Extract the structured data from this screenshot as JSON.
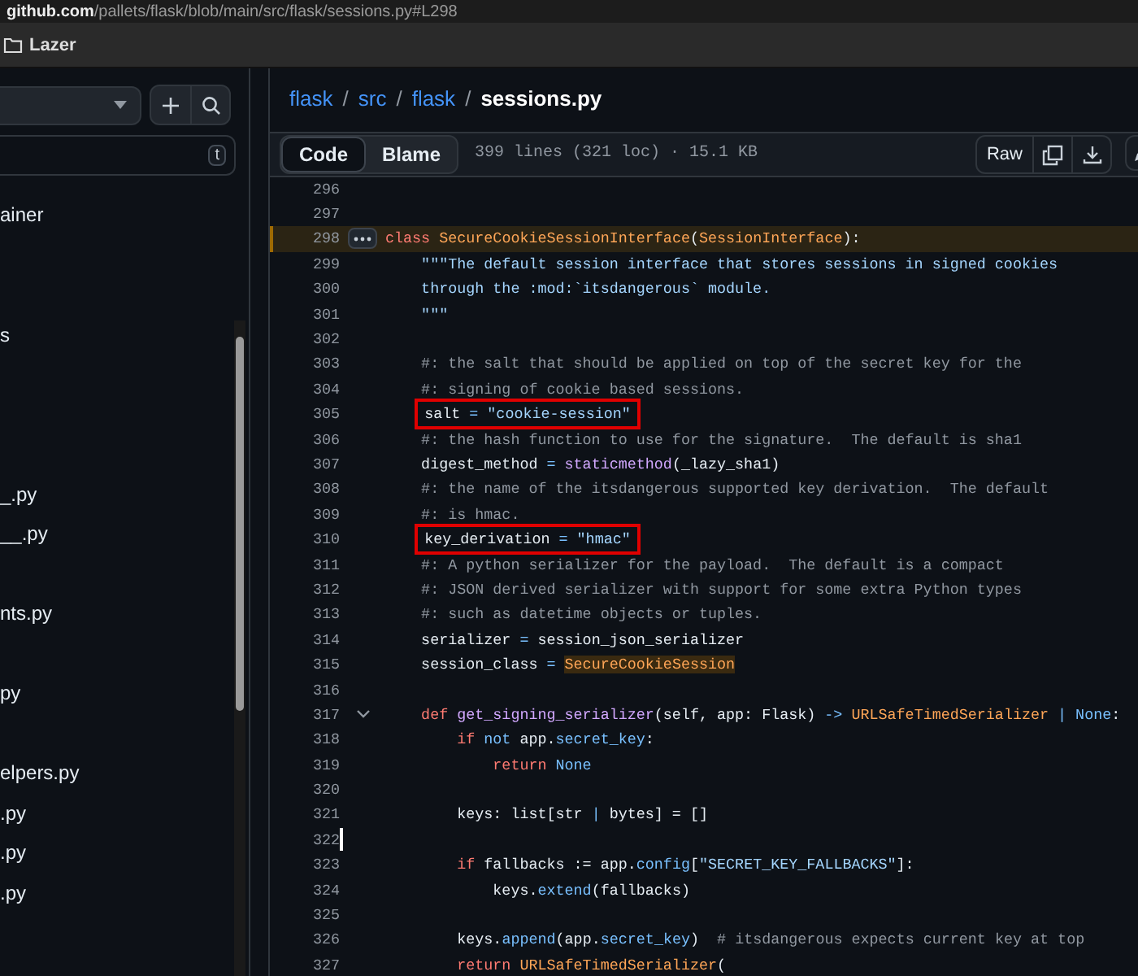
{
  "address_bar": {
    "host": "github.com",
    "path": "/pallets/flask/blob/main/src/flask/sessions.py#L298"
  },
  "bookmarks": [
    {
      "label": "Lazer"
    }
  ],
  "sidebar": {
    "filter_placeholder_key": "t",
    "items": [
      {
        "label": "ainer"
      },
      {
        "label": "s"
      },
      {
        "label": "_.py"
      },
      {
        "label": "__.py"
      },
      {
        "label": "nts.py"
      },
      {
        "label": "py"
      },
      {
        "label": "elpers.py"
      },
      {
        "label": ".py"
      },
      {
        "label": ".py"
      },
      {
        "label": ".py"
      }
    ]
  },
  "breadcrumb": [
    {
      "label": "flask",
      "kind": "link"
    },
    {
      "label": "/",
      "kind": "sep"
    },
    {
      "label": "src",
      "kind": "link"
    },
    {
      "label": "/",
      "kind": "sep"
    },
    {
      "label": "flask",
      "kind": "link"
    },
    {
      "label": "/",
      "kind": "sep"
    },
    {
      "label": "sessions.py",
      "kind": "current"
    }
  ],
  "view_tabs": [
    {
      "label": "Code",
      "selected": true
    },
    {
      "label": "Blame",
      "selected": false
    }
  ],
  "file_info": "399 lines (321 loc) · 15.1 KB",
  "raw_button": "Raw",
  "lines": [
    {
      "number": "296",
      "selected": false,
      "boxed": false
    },
    {
      "number": "297",
      "selected": false,
      "boxed": false
    },
    {
      "number": "298",
      "selected": true,
      "boxed": false,
      "kind": "menu",
      "tokens": [
        {
          "kind": "keyword",
          "text": "class "
        },
        {
          "kind": "type",
          "text": "SecureCookieSessionInterface"
        },
        {
          "kind": "plain",
          "text": "("
        },
        {
          "kind": "type",
          "text": "SessionInterface"
        },
        {
          "kind": "plain",
          "text": "):"
        }
      ]
    },
    {
      "number": "299",
      "selected": false,
      "boxed": false,
      "tokens": [
        {
          "kind": "string",
          "text": "    \"\"\"The default session interface that stores sessions in signed cookies"
        }
      ]
    },
    {
      "number": "300",
      "selected": false,
      "boxed": false,
      "tokens": [
        {
          "kind": "string",
          "text": "    through the :mod:`itsdangerous` module."
        }
      ]
    },
    {
      "number": "301",
      "selected": false,
      "boxed": false,
      "tokens": [
        {
          "kind": "string",
          "text": "    \"\"\""
        }
      ]
    },
    {
      "number": "302",
      "selected": false,
      "boxed": false
    },
    {
      "number": "303",
      "selected": false,
      "boxed": false,
      "tokens": [
        {
          "kind": "comment",
          "text": "    #: the salt that should be applied on top of the secret key for the"
        }
      ]
    },
    {
      "number": "304",
      "selected": false,
      "boxed": false,
      "tokens": [
        {
          "kind": "comment",
          "text": "    #: signing of cookie based sessions."
        }
      ]
    },
    {
      "number": "305",
      "selected": false,
      "boxed": true,
      "tokens": [
        {
          "kind": "plain",
          "text": "    salt "
        },
        {
          "kind": "builtin",
          "text": "="
        },
        {
          "kind": "string",
          "text": " \"cookie-session\""
        }
      ]
    },
    {
      "number": "306",
      "selected": false,
      "boxed": false,
      "tokens": [
        {
          "kind": "comment",
          "text": "    #: the hash function to use for the signature.  The default is sha1"
        }
      ]
    },
    {
      "number": "307",
      "selected": false,
      "boxed": false,
      "tokens": [
        {
          "kind": "plain",
          "text": "    digest_method "
        },
        {
          "kind": "builtin",
          "text": "= "
        },
        {
          "kind": "function",
          "text": "staticmethod"
        },
        {
          "kind": "plain",
          "text": "(_lazy_sha1)"
        }
      ]
    },
    {
      "number": "308",
      "selected": false,
      "boxed": false,
      "tokens": [
        {
          "kind": "comment",
          "text": "    #: the name of the itsdangerous supported key derivation.  The default"
        }
      ]
    },
    {
      "number": "309",
      "selected": false,
      "boxed": false,
      "tokens": [
        {
          "kind": "comment",
          "text": "    #: is hmac."
        }
      ]
    },
    {
      "number": "310",
      "selected": false,
      "boxed": true,
      "tokens": [
        {
          "kind": "plain",
          "text": "    key_derivation "
        },
        {
          "kind": "builtin",
          "text": "="
        },
        {
          "kind": "string",
          "text": " \"hmac\""
        }
      ]
    },
    {
      "number": "311",
      "selected": false,
      "boxed": false,
      "tokens": [
        {
          "kind": "comment",
          "text": "    #: A python serializer for the payload.  The default is a compact"
        }
      ]
    },
    {
      "number": "312",
      "selected": false,
      "boxed": false,
      "tokens": [
        {
          "kind": "comment",
          "text": "    #: JSON derived serializer with support for some extra Python types"
        }
      ]
    },
    {
      "number": "313",
      "selected": false,
      "boxed": false,
      "tokens": [
        {
          "kind": "comment",
          "text": "    #: such as datetime objects or tuples."
        }
      ]
    },
    {
      "number": "314",
      "selected": false,
      "boxed": false,
      "tokens": [
        {
          "kind": "plain",
          "text": "    serializer "
        },
        {
          "kind": "builtin",
          "text": "="
        },
        {
          "kind": "plain",
          "text": " session_json_serializer"
        }
      ]
    },
    {
      "number": "315",
      "selected": false,
      "boxed": false,
      "tokens": [
        {
          "kind": "plain",
          "text": "    session_class "
        },
        {
          "kind": "builtin",
          "text": "= "
        },
        {
          "kind": "match",
          "text": "SecureCookieSession"
        }
      ]
    },
    {
      "number": "316",
      "selected": false,
      "boxed": false
    },
    {
      "number": "317",
      "selected": false,
      "boxed": false,
      "kind": "fold",
      "tokens": [
        {
          "kind": "keyword",
          "text": "    def "
        },
        {
          "kind": "function",
          "text": "get_signing_serializer"
        },
        {
          "kind": "plain",
          "text": "(self, app: Flask) "
        },
        {
          "kind": "builtin",
          "text": "-> "
        },
        {
          "kind": "type",
          "text": "URLSafeTimedSerializer "
        },
        {
          "kind": "builtin",
          "text": "| None"
        },
        {
          "kind": "plain",
          "text": ":"
        }
      ]
    },
    {
      "number": "318",
      "selected": false,
      "boxed": false,
      "tokens": [
        {
          "kind": "keyword",
          "text": "        if "
        },
        {
          "kind": "builtin",
          "text": "not"
        },
        {
          "kind": "plain",
          "text": " app."
        },
        {
          "kind": "builtin",
          "text": "secret_key"
        },
        {
          "kind": "plain",
          "text": ":"
        }
      ]
    },
    {
      "number": "319",
      "selected": false,
      "boxed": false,
      "tokens": [
        {
          "kind": "keyword",
          "text": "            return "
        },
        {
          "kind": "builtin",
          "text": "None"
        }
      ]
    },
    {
      "number": "320",
      "selected": false,
      "boxed": false
    },
    {
      "number": "321",
      "selected": false,
      "boxed": false,
      "tokens": [
        {
          "kind": "plain",
          "text": "        keys: list[str "
        },
        {
          "kind": "builtin",
          "text": "|"
        },
        {
          "kind": "plain",
          "text": " bytes] = []"
        }
      ]
    },
    {
      "number": "322",
      "selected": false,
      "boxed": false,
      "kind": "cursor"
    },
    {
      "number": "323",
      "selected": false,
      "boxed": false,
      "tokens": [
        {
          "kind": "keyword",
          "text": "        if "
        },
        {
          "kind": "plain",
          "text": "fallbacks := app."
        },
        {
          "kind": "builtin",
          "text": "config"
        },
        {
          "kind": "plain",
          "text": "["
        },
        {
          "kind": "string",
          "text": "\"SECRET_KEY_FALLBACKS\""
        },
        {
          "kind": "plain",
          "text": "]:"
        }
      ]
    },
    {
      "number": "324",
      "selected": false,
      "boxed": false,
      "tokens": [
        {
          "kind": "plain",
          "text": "            keys."
        },
        {
          "kind": "builtin",
          "text": "extend"
        },
        {
          "kind": "plain",
          "text": "(fallbacks)"
        }
      ]
    },
    {
      "number": "325",
      "selected": false,
      "boxed": false
    },
    {
      "number": "326",
      "selected": false,
      "boxed": false,
      "tokens": [
        {
          "kind": "plain",
          "text": "        keys."
        },
        {
          "kind": "builtin",
          "text": "append"
        },
        {
          "kind": "plain",
          "text": "(app."
        },
        {
          "kind": "builtin",
          "text": "secret_key"
        },
        {
          "kind": "plain",
          "text": ")  "
        },
        {
          "kind": "comment",
          "text": "# itsdangerous expects current key at top"
        }
      ]
    },
    {
      "number": "327",
      "selected": false,
      "boxed": false,
      "tokens": [
        {
          "kind": "keyword",
          "text": "        return "
        },
        {
          "kind": "type",
          "text": "URLSafeTimedSerializer"
        },
        {
          "kind": "plain",
          "text": "("
        }
      ]
    }
  ]
}
